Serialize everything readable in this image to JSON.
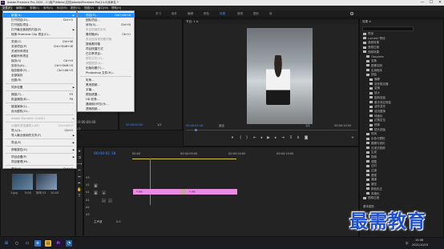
{
  "window": {
    "title": "Adobe Premiere Pro 2020 - C:\\用户\\Nibiru\\文档\\Adobe\\Premiere Pro\\14.0\\未命名 *",
    "minimize": "—",
    "maximize": "☐",
    "close": "✕"
  },
  "menu_bar": [
    "文件(F)",
    "编辑(E)",
    "剪辑(C)",
    "序列(S)",
    "标记(M)",
    "图形(G)",
    "视图(V)",
    "窗口(W)",
    "帮助(H)"
  ],
  "workspaces": [
    "学习",
    "组件",
    "编辑",
    "颜色",
    "效果",
    "音频",
    "图形",
    "库"
  ],
  "file_menu": {
    "items": [
      {
        "label": "新建(N)",
        "shortcut": "",
        "submenu": true,
        "highlight": true
      },
      {
        "label": "打开项目(O)...",
        "shortcut": "Ctrl+O"
      },
      {
        "label": "打开团队项目...",
        "shortcut": ""
      },
      {
        "label": "打开最近使用的内容(E)",
        "shortcut": "",
        "submenu": true
      },
      {
        "label": "转换 Premiere Clip 项目(C)...",
        "shortcut": ""
      },
      {
        "label": "关闭(C)",
        "shortcut": "Ctrl+W",
        "sep_before": true
      },
      {
        "label": "关闭项目(P)",
        "shortcut": "Ctrl+Shift+W"
      },
      {
        "label": "关闭所有项目",
        "shortcut": ""
      },
      {
        "label": "刷新所有项目",
        "shortcut": ""
      },
      {
        "label": "保存(S)",
        "shortcut": "Ctrl+S"
      },
      {
        "label": "另存为(A)...",
        "shortcut": "Ctrl+Shift+S"
      },
      {
        "label": "保存副本(Y)...",
        "shortcut": "Ctrl+Alt+S"
      },
      {
        "label": "全部保存",
        "shortcut": ""
      },
      {
        "label": "还原(R)",
        "shortcut": ""
      },
      {
        "label": "同步设置",
        "shortcut": "",
        "submenu": true,
        "sep_before": true
      },
      {
        "label": "捕捉(T)...",
        "shortcut": "F5",
        "sep_before": true
      },
      {
        "label": "批量捕捉(B)...",
        "shortcut": "F6"
      },
      {
        "label": "链接媒体(L)...",
        "shortcut": "",
        "sep_before": true
      },
      {
        "label": "设为脱机(O)...",
        "shortcut": ""
      },
      {
        "label": "Adobe Dynamic Link(K)",
        "shortcut": "",
        "submenu": true,
        "sep_before": true,
        "disabled": true
      },
      {
        "label": "从媒体浏览器导入(M)",
        "shortcut": "Ctrl+Alt+I",
        "sep_before": true,
        "disabled": true
      },
      {
        "label": "导入(I)...",
        "shortcut": "Ctrl+I"
      },
      {
        "label": "导入最近使用的文件(F)",
        "shortcut": "",
        "submenu": true
      },
      {
        "label": "导出(E)",
        "shortcut": "",
        "submenu": true,
        "sep_before": true
      },
      {
        "label": "获取属性(G)",
        "shortcut": "",
        "submenu": true,
        "sep_before": true
      },
      {
        "label": "项目设置(P)",
        "shortcut": "",
        "submenu": true,
        "sep_before": true
      },
      {
        "label": "项目管理(M)...",
        "shortcut": ""
      },
      {
        "label": "退出(X)",
        "shortcut": "Ctrl+Q",
        "sep_before": true
      }
    ]
  },
  "new_submenu": {
    "items": [
      {
        "label": "项目(P)...",
        "shortcut": "Ctrl+Alt+N",
        "highlight": true
      },
      {
        "label": "团队项目...",
        "shortcut": ""
      },
      {
        "label": "序列(S)...",
        "shortcut": "Ctrl+N"
      },
      {
        "label": "来自剪辑的序列",
        "shortcut": "",
        "disabled": true
      },
      {
        "label": "素材箱(B)",
        "shortcut": "Ctrl+/"
      },
      {
        "label": "来自选择项的素材箱",
        "shortcut": "",
        "disabled": true
      },
      {
        "label": "搜索素材箱",
        "shortcut": ""
      },
      {
        "label": "项目快捷方式",
        "shortcut": ""
      },
      {
        "label": "已共享项目...",
        "shortcut": ""
      },
      {
        "label": "脱机文件(O)...",
        "shortcut": "",
        "disabled": true
      },
      {
        "label": "调整图层(A)...",
        "shortcut": "",
        "disabled": true
      },
      {
        "label": "旧版标题(T)...",
        "shortcut": ""
      },
      {
        "label": "Photoshop 文件(H)...",
        "shortcut": ""
      },
      {
        "label": "彩条...",
        "shortcut": "",
        "sep_before": true
      },
      {
        "label": "黑场视频...",
        "shortcut": ""
      },
      {
        "label": "字幕...",
        "shortcut": ""
      },
      {
        "label": "颜色遮罩...",
        "shortcut": ""
      },
      {
        "label": "HD 彩条...",
        "shortcut": ""
      },
      {
        "label": "通用倒计时片头...",
        "shortcut": ""
      },
      {
        "label": "透明视频...",
        "shortcut": ""
      }
    ]
  },
  "source_monitor": {
    "timecode": "00:00:00:00",
    "zoom": "1/2"
  },
  "program_monitor": {
    "tab": "节目: 1 ≡",
    "timecode": "00:00:01:18",
    "fit": "适合",
    "zoom": "1/2",
    "duration": "00:00:10:05"
  },
  "center_monitor": {
    "timecode": "00:00:00:00",
    "zoom": "1/2",
    "end": "00:00:10:00"
  },
  "timeline": {
    "timecode": "00:00:01:18",
    "ruler": [
      "00:00",
      "00:00:05:00",
      "00:00:10:00",
      "00:00:15:00"
    ],
    "clips": [
      "1.jpg",
      "1.jpg"
    ],
    "tracks": [
      "V3",
      "V2",
      "V1",
      "A1",
      "A2",
      "A3"
    ],
    "master": "主声道",
    "master_val": "0.0"
  },
  "effects_panel": {
    "title": "效果 ≡",
    "rows": [
      "预设",
      "Lumetri 预设",
      "音频效果",
      "音频过渡",
      "视频效果",
      "Obsolete",
      "变换",
      "图像控制",
      "实用程序",
      "扭曲",
      "偏移",
      "变形稳定器",
      "变换",
      "放大",
      "旋转扭曲",
      "果冻效应修复",
      "波形变形",
      "湍流置换",
      "球面化",
      "边角定位",
      "镜像",
      "镜头扭曲",
      "时间",
      "杂色与颗粒",
      "模糊与锐化",
      "沉浸式视频",
      "生成",
      "视频",
      "调整",
      "过时",
      "过渡",
      "透视",
      "通道",
      "键控",
      "颜色校正",
      "风格化",
      "视频过渡"
    ],
    "bottom": [
      "基本图形",
      "基本声音",
      "Lumetri 颜色",
      "库"
    ]
  },
  "project_panel": {
    "tab": "项目: 未命名 ≡",
    "items": [
      "1.jpg",
      "序列 01"
    ],
    "durations": [
      "5:00",
      "10:05"
    ]
  },
  "taskbar": {
    "clock": "15:08",
    "date": "2021/10/15",
    "lang": "中"
  },
  "watermark": "最需教育",
  "colors": {
    "accent": "#3d8fff",
    "clip_pink": "#e98be2",
    "highlight": "#1e90ff"
  }
}
